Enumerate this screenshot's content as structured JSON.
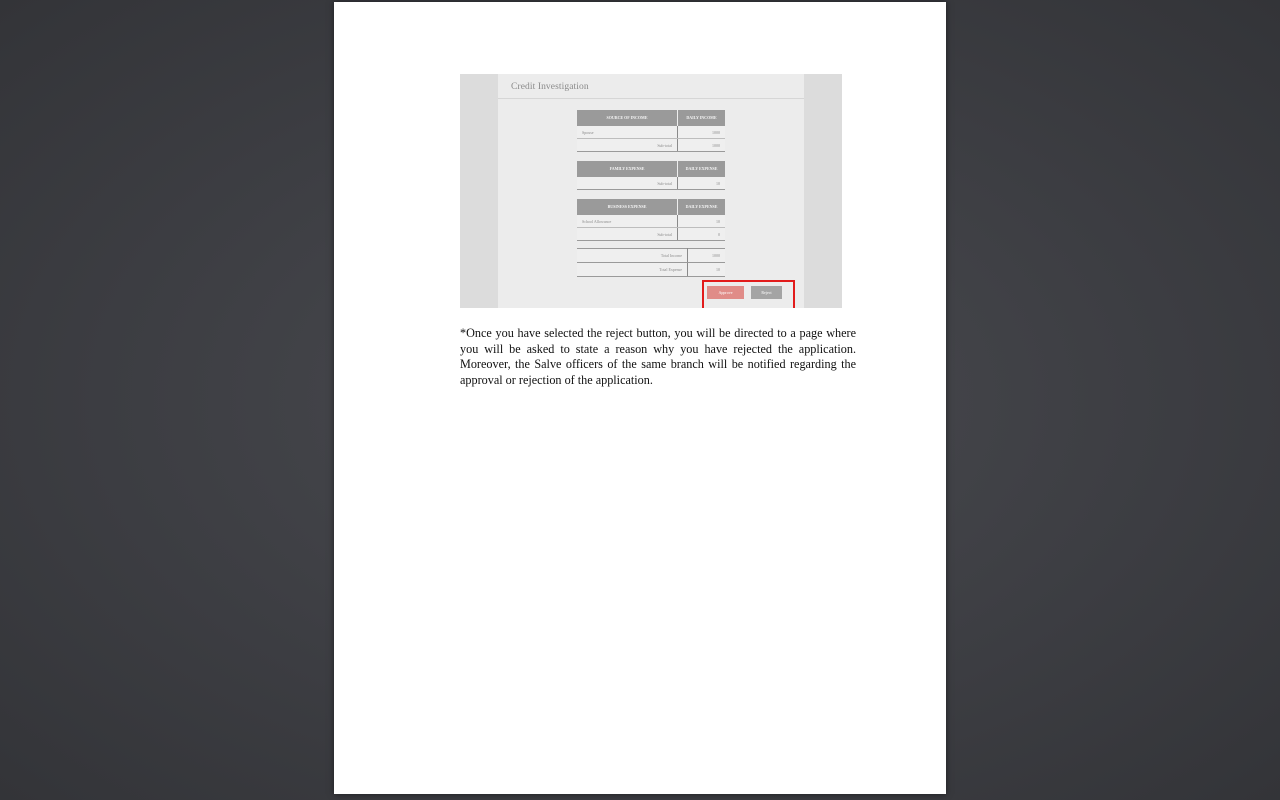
{
  "screenshot": {
    "title": "Credit Investigation",
    "income_table": {
      "headers": [
        "SOURCE OF INCOME",
        "DAILY INCOME"
      ],
      "rows": [
        [
          "Spouse",
          "1000"
        ]
      ],
      "subtotal_label": "Sub-total",
      "subtotal_value": "1000"
    },
    "family_table": {
      "headers": [
        "FAMILY EXPENSE",
        "DAILY EXPENSE"
      ],
      "subtotal_label": "Sub-total",
      "subtotal_value": "10"
    },
    "business_table": {
      "headers": [
        "BUSINESS EXPENSE",
        "DAILY EXPENSE"
      ],
      "rows": [
        [
          "School Allowance",
          "10"
        ]
      ],
      "subtotal_label": "Sub-total",
      "subtotal_value": "0"
    },
    "totals": [
      [
        "Total Income",
        "1000"
      ],
      [
        "Total Expense",
        "10"
      ]
    ],
    "approve_label": "Approve",
    "reject_label": "Reject"
  },
  "note": "*Once you have selected the reject button, you will be directed to a page where you will be asked to state a reason why you have rejected the application. Moreover, the Salve officers of the same branch will be notified regarding the approval or rejection of the application.",
  "colors": {
    "highlight": "#e21b1b",
    "approve": "#e08c88",
    "reject": "#a4a4a4"
  }
}
